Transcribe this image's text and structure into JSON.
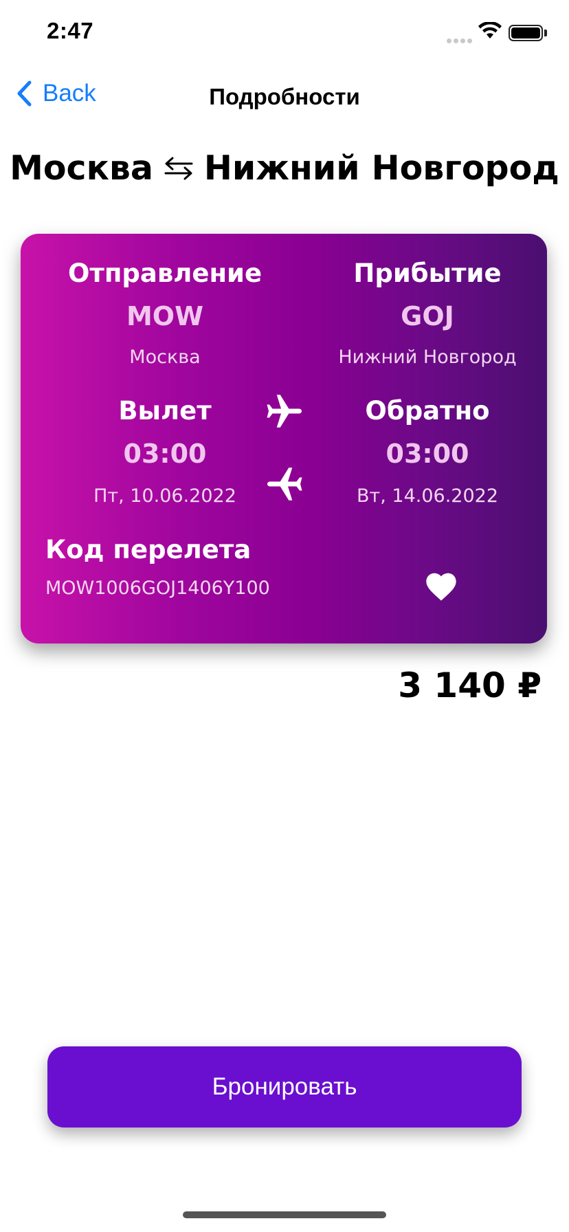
{
  "status_bar": {
    "time": "2:47"
  },
  "nav": {
    "back_label": "Back",
    "title": "Подробности"
  },
  "route": {
    "from": "Москва",
    "to": "Нижний Новгород"
  },
  "card": {
    "departure_label": "Отправление",
    "departure_code": "MOW",
    "departure_city": "Москва",
    "arrival_label": "Прибытие",
    "arrival_code": "GOJ",
    "arrival_city": "Нижний Новгород",
    "outbound_label": "Вылет",
    "outbound_time": "03:00",
    "outbound_date": "Пт, 10.06.2022",
    "return_label": "Обратно",
    "return_time": "03:00",
    "return_date": "Вт, 14.06.2022",
    "flight_code_label": "Код перелета",
    "flight_code": "MOW1006GOJ1406Y100",
    "gradient_colors": [
      "#c712a9",
      "#8a0093",
      "#4a0f70"
    ]
  },
  "price": "3 140 ₽",
  "book_button_label": "Бронировать",
  "colors": {
    "accent_link": "#157efb",
    "button": "#6a0fcf"
  }
}
